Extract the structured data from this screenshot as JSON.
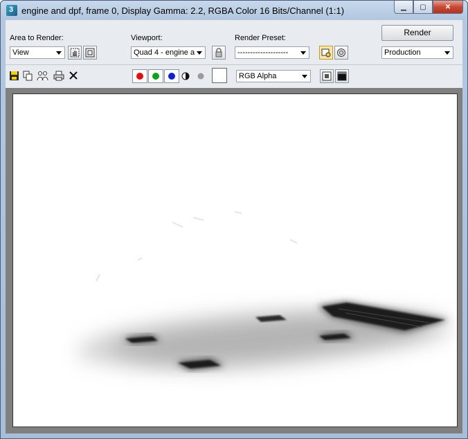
{
  "window": {
    "title": "engine and dpf, frame 0, Display Gamma: 2.2, RGBA Color 16 Bits/Channel (1:1)",
    "accent": "#a7bdd8"
  },
  "caption_buttons": {
    "minimize": "▁",
    "maximize": "▢",
    "close": "✕"
  },
  "toolbar": {
    "area_label": "Area to Render:",
    "area_value": "View",
    "viewport_label": "Viewport:",
    "viewport_value": "Quad 4 - engine a",
    "preset_label": "Render Preset:",
    "preset_value": "--------------------",
    "render_label": "Render",
    "mode_value": "Production"
  },
  "channels": {
    "red": "#e01010",
    "green": "#10a020",
    "blue": "#1020d0",
    "display_value": "RGB Alpha"
  },
  "icons": [
    "save-icon",
    "copy-icon",
    "clone-icon",
    "print-icon",
    "clear-icon",
    "edit-region-icon",
    "auto-region-icon",
    "lock-icon",
    "environment-icon",
    "render-settings-icon",
    "monochrome-icon",
    "alpha-icon",
    "split-view-icon",
    "display-icon"
  ]
}
